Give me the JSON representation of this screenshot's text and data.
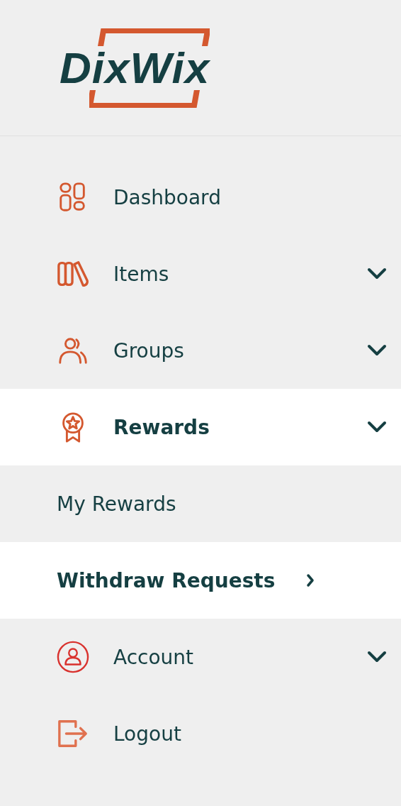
{
  "logo": {
    "text": "DixWix"
  },
  "nav": [
    {
      "label": "Dashboard",
      "kind": "link",
      "selected": false
    },
    {
      "label": "Items",
      "kind": "group",
      "selected": false
    },
    {
      "label": "Groups",
      "kind": "group",
      "selected": false
    },
    {
      "label": "Rewards",
      "kind": "group",
      "selected": true,
      "children": [
        {
          "label": "My Rewards",
          "selected": false
        },
        {
          "label": "Withdraw Requests",
          "selected": true
        }
      ]
    },
    {
      "label": "Account",
      "kind": "group",
      "selected": false
    },
    {
      "label": "Logout",
      "kind": "link",
      "selected": false
    }
  ]
}
